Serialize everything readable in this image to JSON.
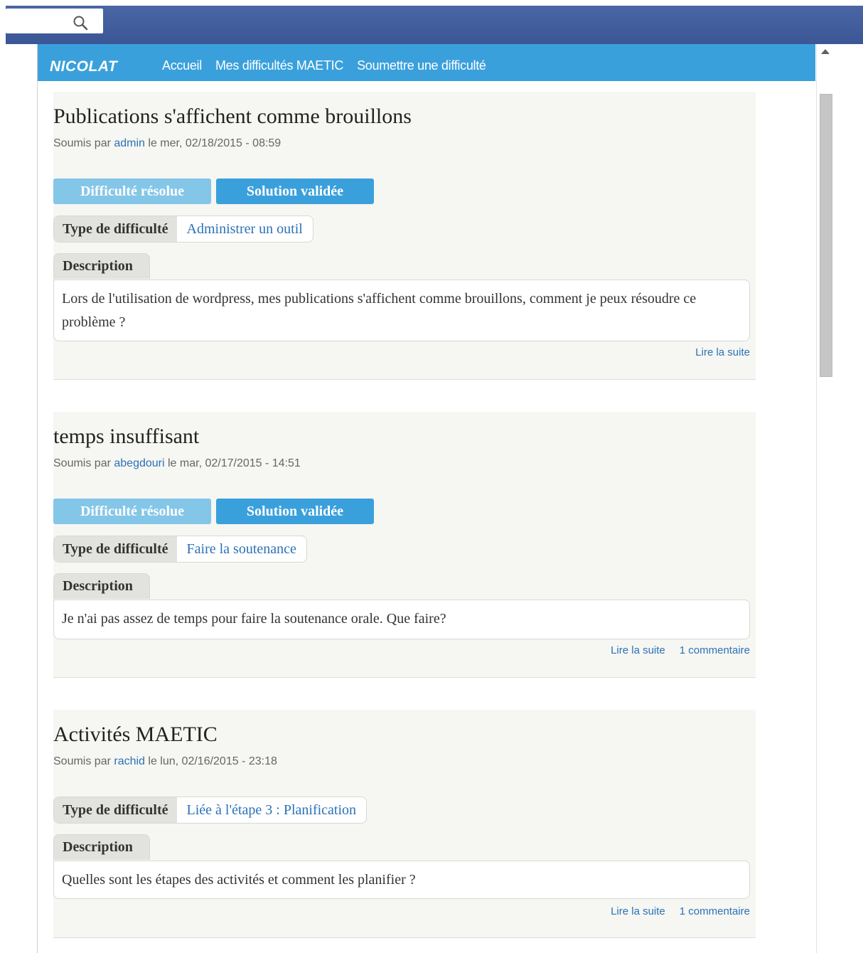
{
  "header": {
    "search_icon": "search-icon"
  },
  "navbar": {
    "brand": "NICOLAT",
    "links": [
      "Accueil",
      "Mes difficultés MAETIC",
      "Soumettre une difficulté"
    ]
  },
  "labels": {
    "submitted_prefix": "Soumis par",
    "type_label": "Type de difficulté",
    "description_label": "Description",
    "resolved_button": "Difficulté résolue",
    "validated_button": "Solution validée",
    "read_more": "Lire la suite"
  },
  "nodes": [
    {
      "title": "Publications s'affichent comme brouillons",
      "author": "admin",
      "date": "le mer, 02/18/2015 - 08:59",
      "type": "Administrer un outil",
      "description": "Lors de l'utilisation de wordpress, mes publications s'affichent comme brouillons, comment je peux résoudre ce problème ?",
      "comments": ""
    },
    {
      "title": "temps insuffisant",
      "author": "abegdouri",
      "date": "le mar, 02/17/2015 - 14:51",
      "type": "Faire la soutenance",
      "description": "Je n'ai pas assez de temps pour faire la soutenance orale. Que faire?",
      "comments": "1 commentaire"
    },
    {
      "title": "Activités MAETIC",
      "author": "rachid",
      "date": "le lun, 02/16/2015 - 23:18",
      "type": "Liée à l'étape 3 : Planification",
      "description": "Quelles sont les étapes des activités et comment les planifier ?",
      "comments": "1 commentaire"
    }
  ]
}
